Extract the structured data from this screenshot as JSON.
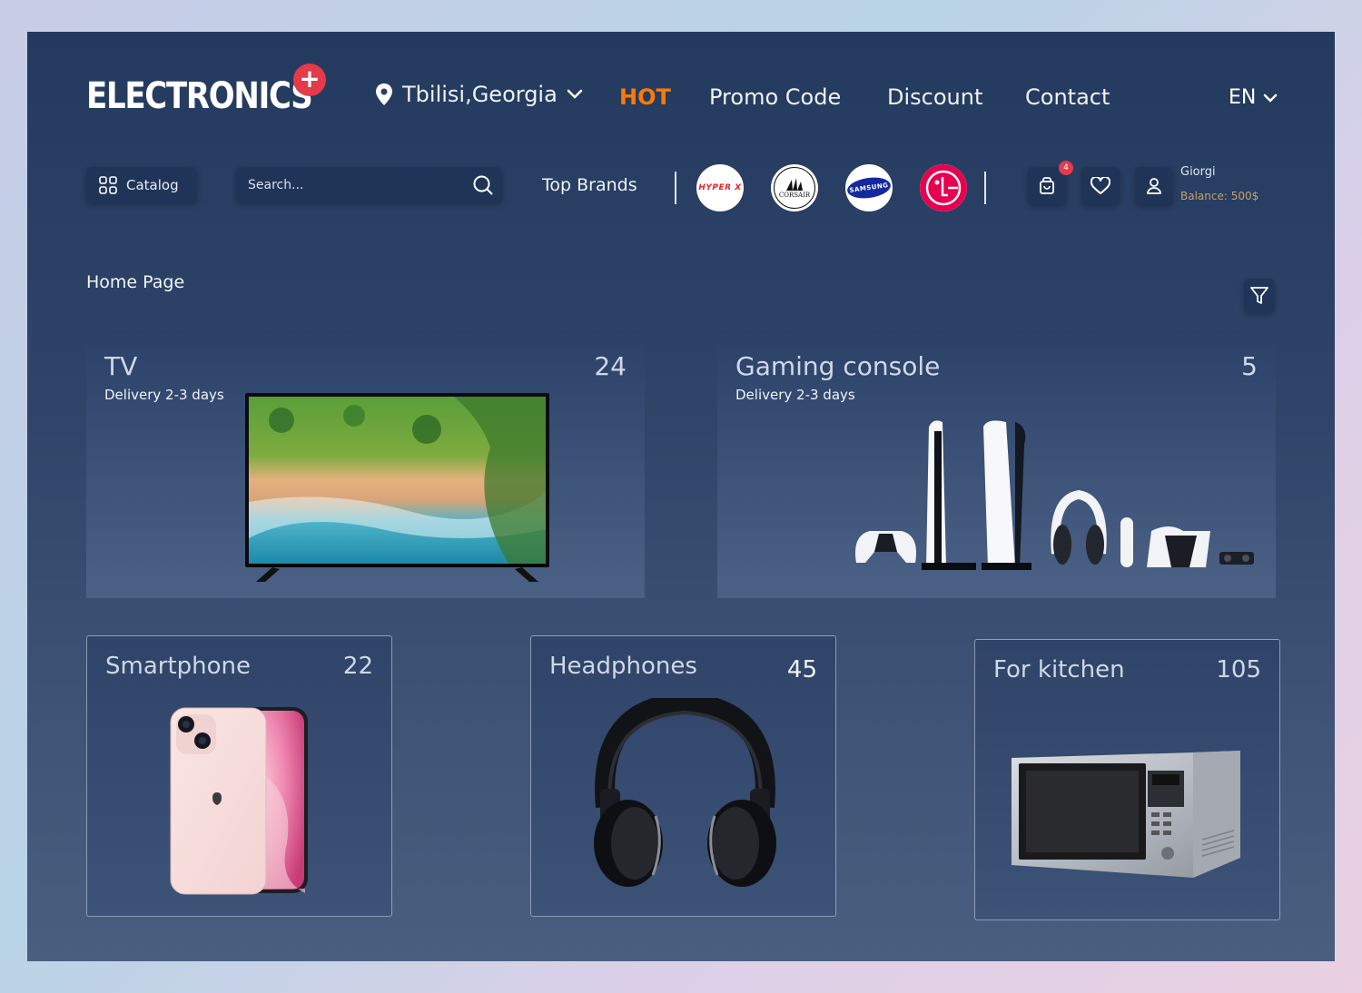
{
  "header": {
    "logo": "ELECTRONICS",
    "logo_plus": "+",
    "location": "Tbilisi,Georgia",
    "nav": {
      "hot": "HOT",
      "promo": "Promo Code",
      "discount": "Discount",
      "contact": "Contact"
    },
    "language": "EN"
  },
  "toolbar": {
    "catalog_label": "Catalog",
    "search_placeholder": "Search...",
    "top_brands_label": "Top Brands",
    "brands": [
      "HYPER X",
      "CORSAIR",
      "SAMSUNG",
      "LG"
    ],
    "cart_count": "4",
    "user": {
      "name": "Giorgi",
      "balance": "Balance: 500$"
    }
  },
  "breadcrumb": "Home Page",
  "categories": [
    {
      "title": "TV",
      "count": "24",
      "delivery": "Delivery 2-3 days"
    },
    {
      "title": "Gaming console",
      "count": "5",
      "delivery": "Delivery 2-3 days"
    },
    {
      "title": "Smartphone",
      "count": "22"
    },
    {
      "title": "Headphones",
      "count": "45"
    },
    {
      "title": "For kitchen",
      "count": "105"
    }
  ],
  "colors": {
    "accent_hot": "#ff7a00",
    "badge_red": "#e43a4a",
    "background_top": "#233a5e",
    "background_bottom": "#4a5f80"
  }
}
